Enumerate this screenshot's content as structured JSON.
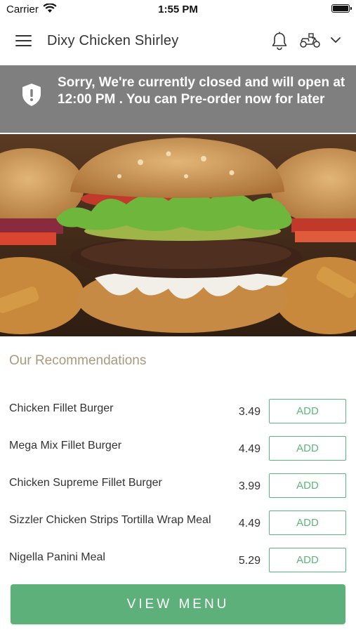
{
  "status_bar": {
    "carrier": "Carrier",
    "time": "1:55 PM"
  },
  "header": {
    "title": "Dixy Chicken Shirley",
    "icons": [
      "menu-icon",
      "bell-icon",
      "scooter-icon",
      "chevron-down-icon"
    ]
  },
  "banner": {
    "icon": "shield-alert-icon",
    "text": "Sorry, We're currently closed and will open at 12:00 PM . You can Pre-order now for later",
    "background": "#7f7f7f"
  },
  "recommendations": {
    "title": "Our Recommendations",
    "add_label": "ADD",
    "items": [
      {
        "name": "Chicken Fillet Burger",
        "price": "3.49"
      },
      {
        "name": "Mega Mix Fillet Burger",
        "price": "4.49"
      },
      {
        "name": "Chicken Supreme Fillet Burger",
        "price": "3.99"
      },
      {
        "name": "Sizzler Chicken Strips Tortilla Wrap Meal",
        "price": "4.49"
      },
      {
        "name": "Nigella Panini Meal",
        "price": "5.29"
      }
    ]
  },
  "view_menu_label": "VIEW MENU",
  "colors": {
    "accent_green": "#5eb07a",
    "recommendations_title": "#a89a7c"
  }
}
